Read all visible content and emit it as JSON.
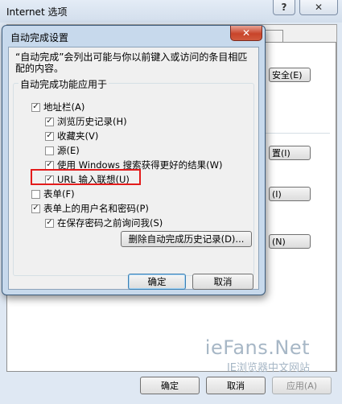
{
  "background_window": {
    "title": "Internet 选项",
    "help_label": "?",
    "close_label": "✕",
    "buttons": {
      "security": "安全(E)",
      "settings": "置(I)",
      "btn_i": "(I)",
      "btn_n": "(N)"
    },
    "ok_label": "确定",
    "cancel_label": "取消",
    "apply_label": "应用(A)"
  },
  "watermark": {
    "brand": "ieFans.Net",
    "subtitle": "IE浏览器中文网站"
  },
  "dialog": {
    "title": "自动完成设置",
    "close_label": "✕",
    "description": "“自动完成”会列出可能与你以前键入或访问的条目相匹配的内容。",
    "group_label": "自动完成功能应用于",
    "options": [
      {
        "label": "地址栏(A)",
        "checked": true
      },
      {
        "label": "浏览历史记录(H)",
        "checked": true
      },
      {
        "label": "收藏夹(V)",
        "checked": true
      },
      {
        "label": "源(E)",
        "checked": false
      },
      {
        "label": "使用 Windows 搜索获得更好的结果(W)",
        "checked": true
      },
      {
        "label": "URL 输入联想(U)",
        "checked": true
      },
      {
        "label": "表单(F)",
        "checked": false
      },
      {
        "label": "表单上的用户名和密码(P)",
        "checked": true
      },
      {
        "label": "在保存密码之前询问我(S)",
        "checked": true
      }
    ],
    "delete_history_label": "删除自动完成历史记录(D)...",
    "ok_label": "确定",
    "cancel_label": "取消",
    "highlight_color": "#e31b1b"
  }
}
